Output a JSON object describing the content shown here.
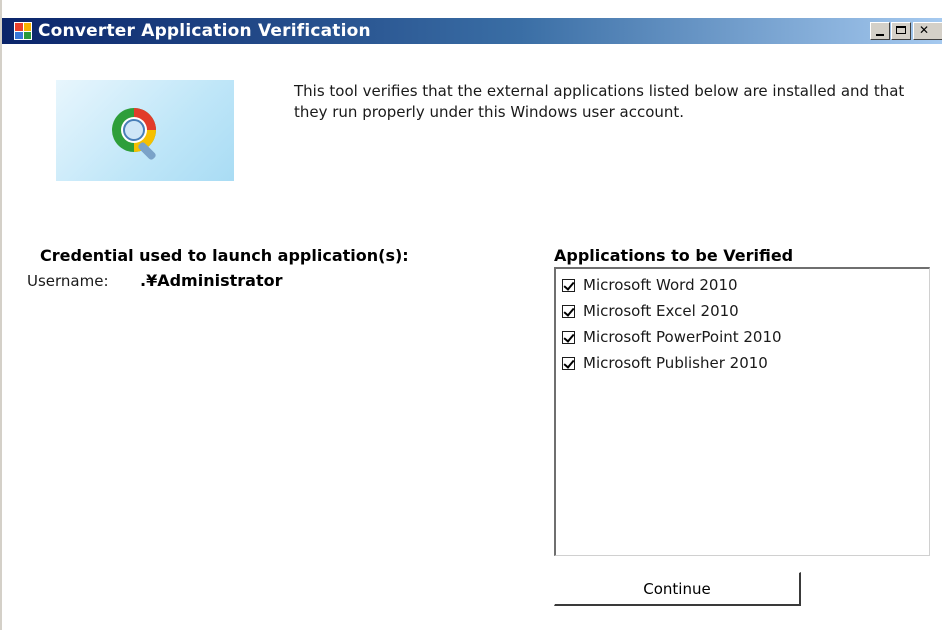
{
  "window": {
    "title": "Converter Application Verification"
  },
  "banner": {
    "icon": "magnifier-search-icon"
  },
  "description": "This tool verifies that the external applications listed below are installed and that they run properly under this Windows user account.",
  "credential": {
    "heading": "Credential used to launch application(s):",
    "username_label": "Username:",
    "username_value": ".¥Administrator"
  },
  "applications": {
    "heading": "Applications to be Verified",
    "items": [
      {
        "label": "Microsoft Word 2010",
        "checked": true
      },
      {
        "label": "Microsoft Excel 2010",
        "checked": true
      },
      {
        "label": "Microsoft PowerPoint 2010",
        "checked": true
      },
      {
        "label": "Microsoft Publisher 2010",
        "checked": true
      }
    ]
  },
  "buttons": {
    "continue_label": "Continue"
  },
  "colors": {
    "titlebar_start": "#0a246a",
    "titlebar_end": "#a6caf0"
  }
}
